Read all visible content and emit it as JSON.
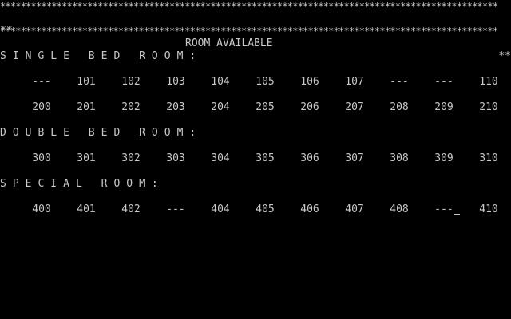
{
  "screen": {
    "border_top": "*************************************************************************************************",
    "border_bottom": "*************************************************************************************************",
    "title_left_marker": "**",
    "title_right_marker": "**",
    "title": "ROOM AVAILABLE"
  },
  "sections": [
    {
      "label": "SINGLE BED ROOM:",
      "rows": [
        [
          "---",
          "101",
          "102",
          "103",
          "104",
          "105",
          "106",
          "107",
          "---",
          "---",
          "110"
        ],
        [
          "200",
          "201",
          "202",
          "203",
          "204",
          "205",
          "206",
          "207",
          "208",
          "209",
          "210"
        ]
      ]
    },
    {
      "label": "DOUBLE BED ROOM:",
      "rows": [
        [
          "300",
          "301",
          "302",
          "303",
          "304",
          "305",
          "306",
          "307",
          "308",
          "309",
          "310"
        ]
      ]
    },
    {
      "label": "SPECIAL ROOM:",
      "rows": [
        [
          "400",
          "401",
          "402",
          "---",
          "404",
          "405",
          "406",
          "407",
          "408",
          "---",
          "410"
        ]
      ]
    }
  ],
  "colors": {
    "background": "#000000",
    "text": "#c8c8c8"
  }
}
